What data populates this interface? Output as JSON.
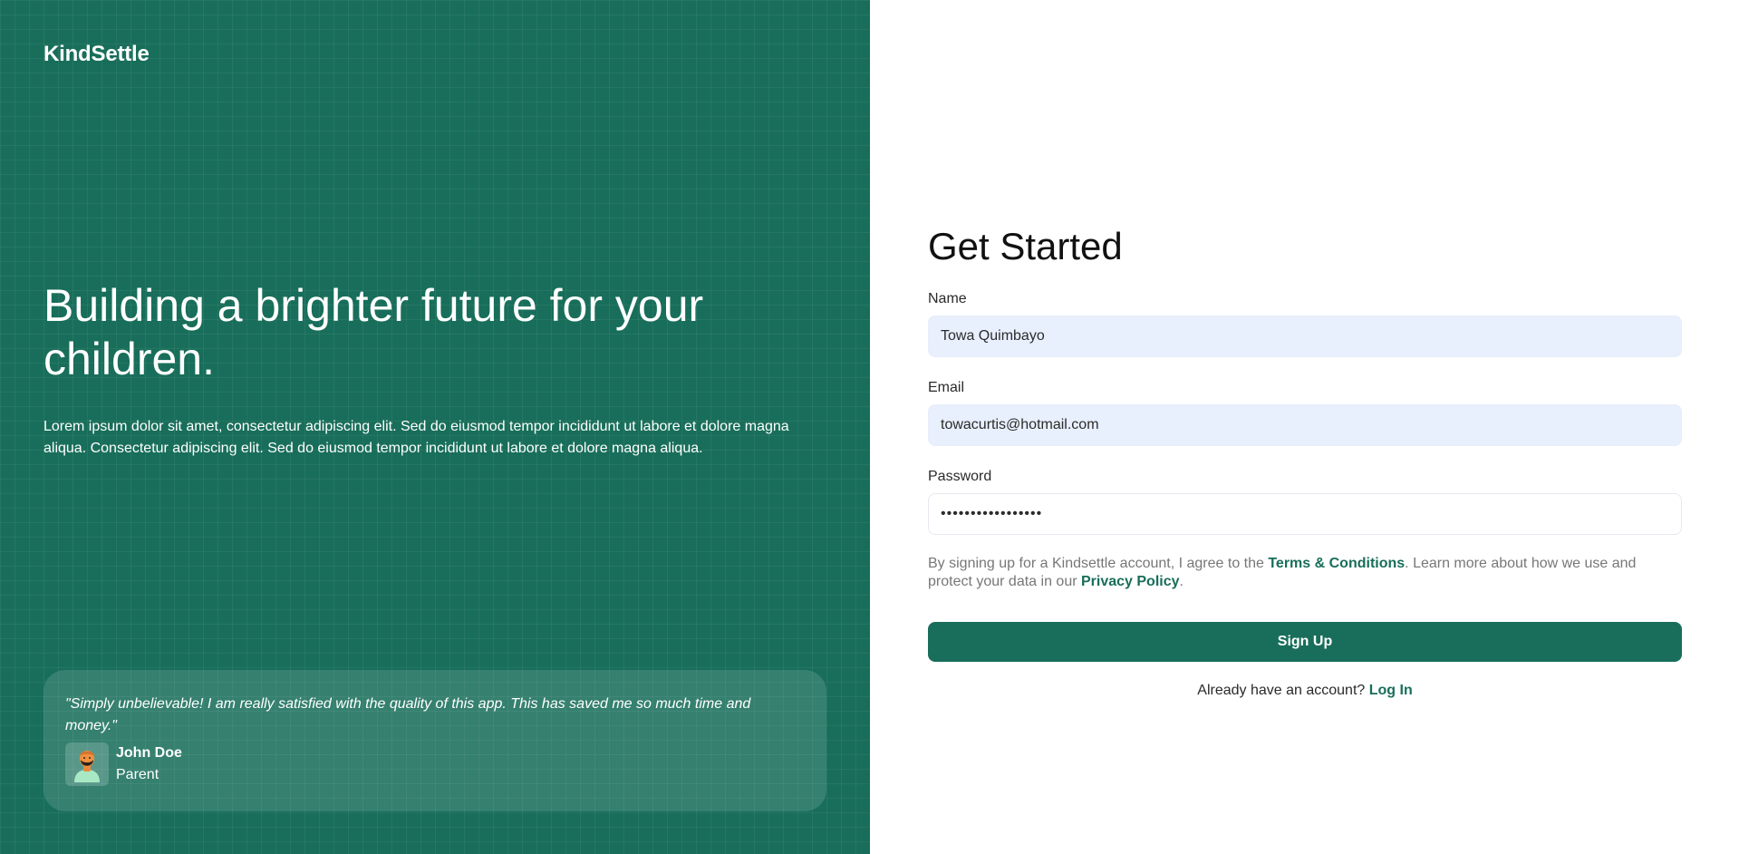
{
  "brand": {
    "name": "KindSettle"
  },
  "hero": {
    "title": "Building a brighter future for your children.",
    "text": "Lorem ipsum dolor sit amet, consectetur adipiscing elit. Sed do eiusmod tempor incididunt ut labore et dolore magna aliqua. Consectetur adipiscing elit. Sed do eiusmod tempor incididunt ut labore et dolore magna aliqua."
  },
  "testimonial": {
    "quote": "\"Simply unbelievable! I am really satisfied with the quality of this app. This has saved me so much time and money.\"",
    "author_name": "John Doe",
    "author_role": "Parent",
    "avatar_icon": "person-avatar-icon"
  },
  "form": {
    "title": "Get Started",
    "name_label": "Name",
    "name_value": "Towa Quimbayo",
    "email_label": "Email",
    "email_value": "towacurtis@hotmail.com",
    "password_label": "Password",
    "password_value": "•••••••••••••••••",
    "legal_prefix": "By signing up for a Kindsettle account, I agree to the ",
    "terms_link": "Terms & Conditions",
    "legal_middle": ". Learn more about how we use and protect your data in our ",
    "privacy_link": "Privacy Policy",
    "legal_suffix": ".",
    "signup_label": "Sign Up",
    "login_prompt": "Already have an account? ",
    "login_link": "Log In"
  },
  "colors": {
    "brand_green": "#186e5a",
    "input_fill": "#e8effd",
    "muted_text": "#777777"
  }
}
